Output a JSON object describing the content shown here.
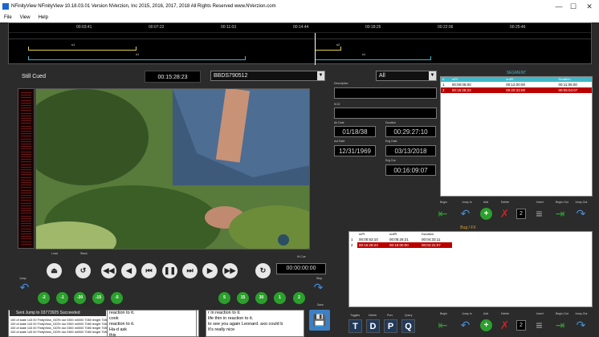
{
  "window": {
    "title": "NFinityView NFinityView 10.18.03.01 Version NVerzion, Inc 2015, 2016, 2017, 2018 All Rights Reserved www.NVerzion.com",
    "min": "—",
    "max": "☐",
    "close": "✕"
  },
  "menu": [
    "File",
    "View",
    "Help"
  ],
  "timeline": {
    "ticks": [
      "00:03:41",
      "00:07:22",
      "00:11:03",
      "00:14:44",
      "00:18:25",
      "00:22:06",
      "00:25:46"
    ],
    "seg_labels": [
      "s1",
      "s1",
      "s1",
      "s2"
    ]
  },
  "player": {
    "status": "Still Cued",
    "timecode": "00:15:28:23",
    "house_id": "BBDS790512",
    "filter": "All"
  },
  "info": {
    "labels": [
      "Description",
      "SCD",
      "Air Date",
      "Duration",
      "Act Date",
      "Eng Date",
      "Eng Dur"
    ],
    "air_date": "01/18/38",
    "duration": "00:29:27:10",
    "act_date": "12/31/1969",
    "eng_date": "03/13/2018",
    "eng_dur": "00:16:09:07"
  },
  "segment": {
    "title": "SEGMENT",
    "columns": [
      "#",
      "mPt",
      "outPt",
      "Duration"
    ],
    "rows": [
      [
        "1",
        "00:00:05:00",
        "00:12:00:00",
        "00:11:05:00"
      ],
      [
        "2",
        "00:15:28:23",
        "00:20:33:00",
        "00:05:04:07"
      ]
    ],
    "controls": [
      "Begin",
      "Jump-In",
      "Add",
      "Delete",
      "Insert",
      "Begin-Out",
      "Jump-Out"
    ],
    "count": "2"
  },
  "bug": {
    "title": "Bug / FX",
    "columns": [
      "mPt",
      "outPt",
      "Duration"
    ],
    "rows": [
      [
        "1",
        "00:00:53:10",
        "00:05:26:21",
        "00:04:33:11"
      ],
      [
        "2",
        "00:15:28:23",
        "00:18:00:00",
        "00:02:31:07"
      ]
    ],
    "count": "2"
  },
  "transport": {
    "labels": [
      "Load",
      "Stack",
      "Jump",
      "Hi Cue",
      "Stop"
    ],
    "counter": "00:00:00:00",
    "jumps_back": [
      "-2",
      "-1",
      "-30",
      "-15",
      "-5"
    ],
    "jumps_fwd": [
      "5",
      "15",
      "30",
      "1",
      "2"
    ],
    "save": "Save"
  },
  "log": {
    "status": "Sent Jump to 03773925 Succeeded",
    "lines": [
      "100 of state 143 00 FinityView_GDTe dur 0300 m0000 7080 lenght 7080",
      "100 of state 143 00 FinityView_GDTe dur 0300 m0000 7080 lenght 7080",
      "100 of state 143 00 FinityView_GDTe dur 0300 m0000 7080 lenght 7080",
      "100 of state 143 00 FinityView_GDTe dur 0300 m0000 7080 lenght 7080"
    ]
  },
  "captions": {
    "left": [
      "reaction to it.",
      "cook",
      "reaction to it.",
      "Ha-d ask",
      "this"
    ],
    "right": [
      "r in reaction to it.",
      "life thin in reaction to it.",
      "to see you again Leonard. axo could b",
      "It's really nice"
    ]
  },
  "tdpq": [
    "T",
    "D",
    "P",
    "Q"
  ],
  "tdpq_labels": [
    "Toggles",
    "Delete",
    "Prev",
    "Query"
  ],
  "colors": {
    "accent": "#3fb8c8",
    "selected": "#b00000",
    "yellow": "#e0d04b",
    "green": "#2ca02c"
  }
}
